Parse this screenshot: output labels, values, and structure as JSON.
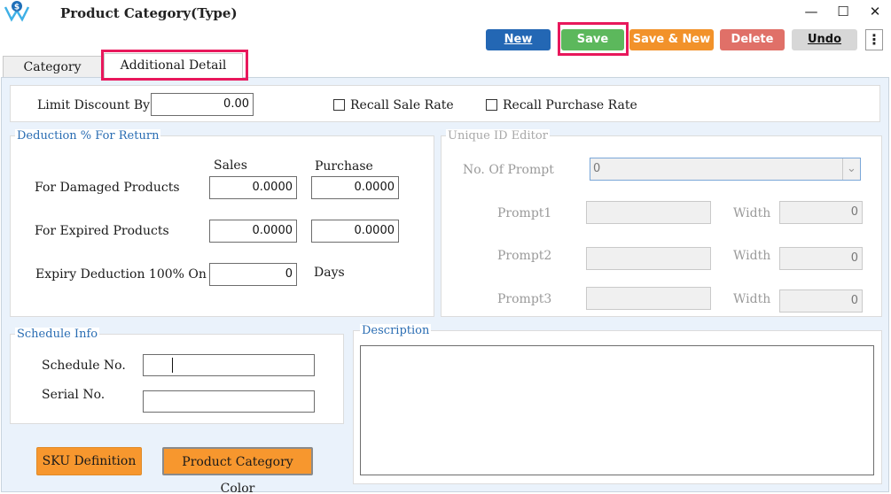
{
  "window": {
    "title": "Product Category(Type)",
    "minimize": "—",
    "maximize": "☐",
    "close": "✕"
  },
  "toolbar": {
    "new_label": "New",
    "save_label": "Save",
    "save_new_label": "Save & New",
    "delete_label": "Delete",
    "undo_label": "Undo",
    "more_label": "⋮"
  },
  "tabs": [
    {
      "label": "Category"
    },
    {
      "label": "Additional Detail"
    }
  ],
  "top_row": {
    "limit_discount_label": "Limit Discount By",
    "limit_discount_value": "0.00",
    "recall_sale_rate_label": "Recall Sale Rate",
    "recall_purchase_rate_label": "Recall Purchase Rate"
  },
  "deduction": {
    "legend": "Deduction % For Return",
    "col_sales": "Sales",
    "col_purchase": "Purchase",
    "damaged_label": "For Damaged Products",
    "damaged_sales": "0.0000",
    "damaged_purchase": "0.0000",
    "expired_label": "For Expired Products",
    "expired_sales": "0.0000",
    "expired_purchase": "0.0000",
    "expiry_label": "Expiry Deduction 100% On",
    "expiry_value": "0",
    "days_label": "Days"
  },
  "unique_id": {
    "legend": "Unique ID Editor",
    "prompt_count_label": "No. Of Prompt",
    "prompt_count_value": "0",
    "prompt1_label": "Prompt1",
    "prompt2_label": "Prompt2",
    "prompt3_label": "Prompt3",
    "width_label": "Width",
    "width1_value": "0",
    "width2_value": "0",
    "width3_value": "0"
  },
  "schedule": {
    "legend": "Schedule Info",
    "schedule_no_label": "Schedule No.",
    "serial_no_label": "Serial No."
  },
  "description": {
    "legend": "Description"
  },
  "bottom_buttons": {
    "sku_label": "SKU Definition",
    "color_label": "Product Category Color"
  }
}
